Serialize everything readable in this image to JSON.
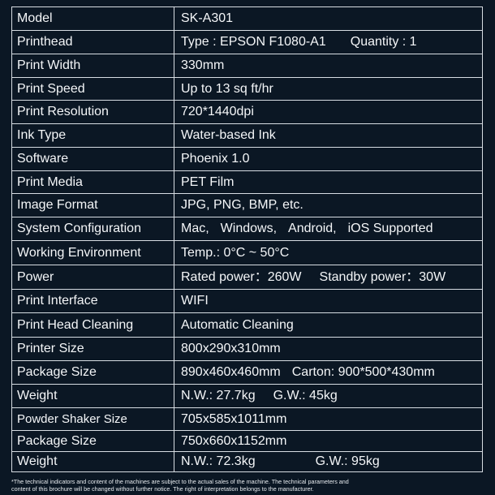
{
  "specs": [
    {
      "label": "Model",
      "value": "SK-A301",
      "h": 29
    },
    {
      "label": "Printhead",
      "value_parts": [
        "Type : EPSON F1080-A1",
        "Quantity : 1"
      ],
      "h": 29
    },
    {
      "label": "Print Width",
      "value": "330mm",
      "h": 29
    },
    {
      "label": "Print Speed",
      "value": "Up to 13 sq ft/hr",
      "h": 28
    },
    {
      "label": "Print Resolution",
      "value": "720*1440dpi",
      "h": 29
    },
    {
      "label": "Ink Type",
      "value": "Water-based Ink",
      "h": 29
    },
    {
      "label": "Software",
      "value": "Phoenix 1.0",
      "h": 29
    },
    {
      "label": "Print Media",
      "value": "PET Film",
      "h": 28
    },
    {
      "label": "Image Format",
      "value": "JPG, PNG, BMP, etc.",
      "h": 29
    },
    {
      "label": "System Configuration",
      "value_parts": [
        "Mac,",
        "Windows,",
        "Android,",
        "iOS Supported"
      ],
      "h": 29
    },
    {
      "label": "Working Environment",
      "value": "Temp.: 0°C ~ 50°C",
      "h": 30
    },
    {
      "label": "Power",
      "value_parts": [
        "Rated power：260W",
        "Standby power：30W"
      ],
      "h": 30
    },
    {
      "label": "Print Interface",
      "value": "WIFI",
      "h": 29
    },
    {
      "label": "Print Head Cleaning",
      "value": "Automatic Cleaning",
      "h": 30
    },
    {
      "label": "Printer Size",
      "value": "800x290x310mm",
      "h": 29
    },
    {
      "label": "Package Size",
      "value_parts": [
        "890x460x460mm",
        "Carton: 900*500*430mm"
      ],
      "h": 29
    },
    {
      "label": "Weight",
      "value_parts": [
        "N.W.: 27.7kg",
        "G.W.: 45kg"
      ],
      "h": 29
    },
    {
      "label": "Powder Shaker Size",
      "value": "705x585x1011mm",
      "h": 28
    },
    {
      "label": "Package Size",
      "value": "750x660x1152mm",
      "h": 26
    },
    {
      "label": "Weight",
      "value_parts": [
        "N.W.: 72.3kg",
        "G.W.: 95kg"
      ],
      "h": 25
    }
  ],
  "footnote": {
    "line1": "*The technical indicators and content of the machines are subject to the actual sales of       the machine. The technical parameters and",
    "line2": "content of this brochure will be changed without further notice. The right of interpretation belongs to the manufacturer."
  }
}
